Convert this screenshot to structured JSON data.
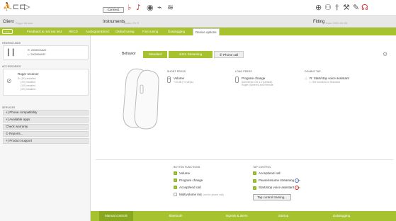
{
  "toolbar": {
    "connect_label": "Connect",
    "left_icons": [
      "person-icon",
      "hearing-aids-icon",
      "forward-icon"
    ],
    "center_icons": [
      "hearing-aid-red-icon",
      "ear-red-icon",
      "sound-icon",
      "link-icon"
    ],
    "right_icons": [
      "globe-icon",
      "people-icon",
      "tools-icon",
      "speaker-icon",
      "wrench-icon",
      "headset-red-icon"
    ]
  },
  "header": {
    "client_label": "Client",
    "client_value": "Roger Mustar",
    "instruments_label": "Instruments",
    "instruments_value": "Audeo Fit R",
    "fitting_label": "Fitting",
    "fitting_value": "Date 2020-03-28"
  },
  "tabs": {
    "back_label": "< >",
    "items": [
      "Feedback & real ear test",
      "RECD",
      "AudiogramDirect",
      "Global tuning",
      "Fine tuning",
      "Datalogging",
      "Device options"
    ],
    "active_index": 6
  },
  "sidebar": {
    "hearing_aids_title": "HEARING AIDS",
    "hearing_aid_r": "R: 2000904A22",
    "hearing_aid_l": "L: 2000904042",
    "accessories_title": "ACCESSORIES",
    "accessory_name": "Roger receiver",
    "accessory_lines": [
      "R: (1/0) installed",
      "(2/0) installed",
      "(1/0) installed",
      "(2/0) installed"
    ],
    "services_title": "SERVICES",
    "services": [
      "Phone compatibility",
      "Available apps",
      "Check warranty",
      "Reports...",
      "Product support"
    ]
  },
  "main": {
    "behavior_label": "Behavior",
    "mode_standard": "Standard",
    "mode_streaming": "Streaming",
    "mode_phone": "Phone call",
    "short_press_title": "SHORT PRESS",
    "short_press_value": "Volume",
    "short_press_detail": "+10 dB (+2 steps)",
    "long_press_title": "LONG PRESS",
    "long_press_value": "Program change",
    "long_press_detail": "AutoSense OS 4.0 (Default)",
    "long_press_detail2": "Roger (Speech) and Remote",
    "double_tap_title": "DOUBLE TAP",
    "double_tap_value": "R: Start/stop voice assistant",
    "double_tap_detail": "L: Set functions in Standard",
    "button_functions_title": "BUTTON FUNCTIONS",
    "button_functions": [
      {
        "label": "Volume",
        "checked": true
      },
      {
        "label": "Program change",
        "checked": true
      },
      {
        "label": "Accept/end call",
        "checked": true
      },
      {
        "label": "Multivolume mic",
        "checked": false,
        "note": "(not for phone call)"
      }
    ],
    "tap_control_title": "TAP CONTROL",
    "tap_controls": [
      {
        "label": "Accept/end call",
        "checked": true
      },
      {
        "label": "Pause/resume streaming",
        "checked": true
      },
      {
        "label": "Start/stop voice assistant",
        "checked": true
      }
    ],
    "tap_training_label": "Tap control training..."
  },
  "bottom_tabs": {
    "items": [
      "Manual controls",
      "Bluetooth",
      "Signals & alerts",
      "Startup",
      "Datalogging"
    ],
    "active_index": 0
  },
  "colors": {
    "accent_green": "#a6c22e",
    "check_green": "#8bb522",
    "alert_red": "#d4262a"
  }
}
